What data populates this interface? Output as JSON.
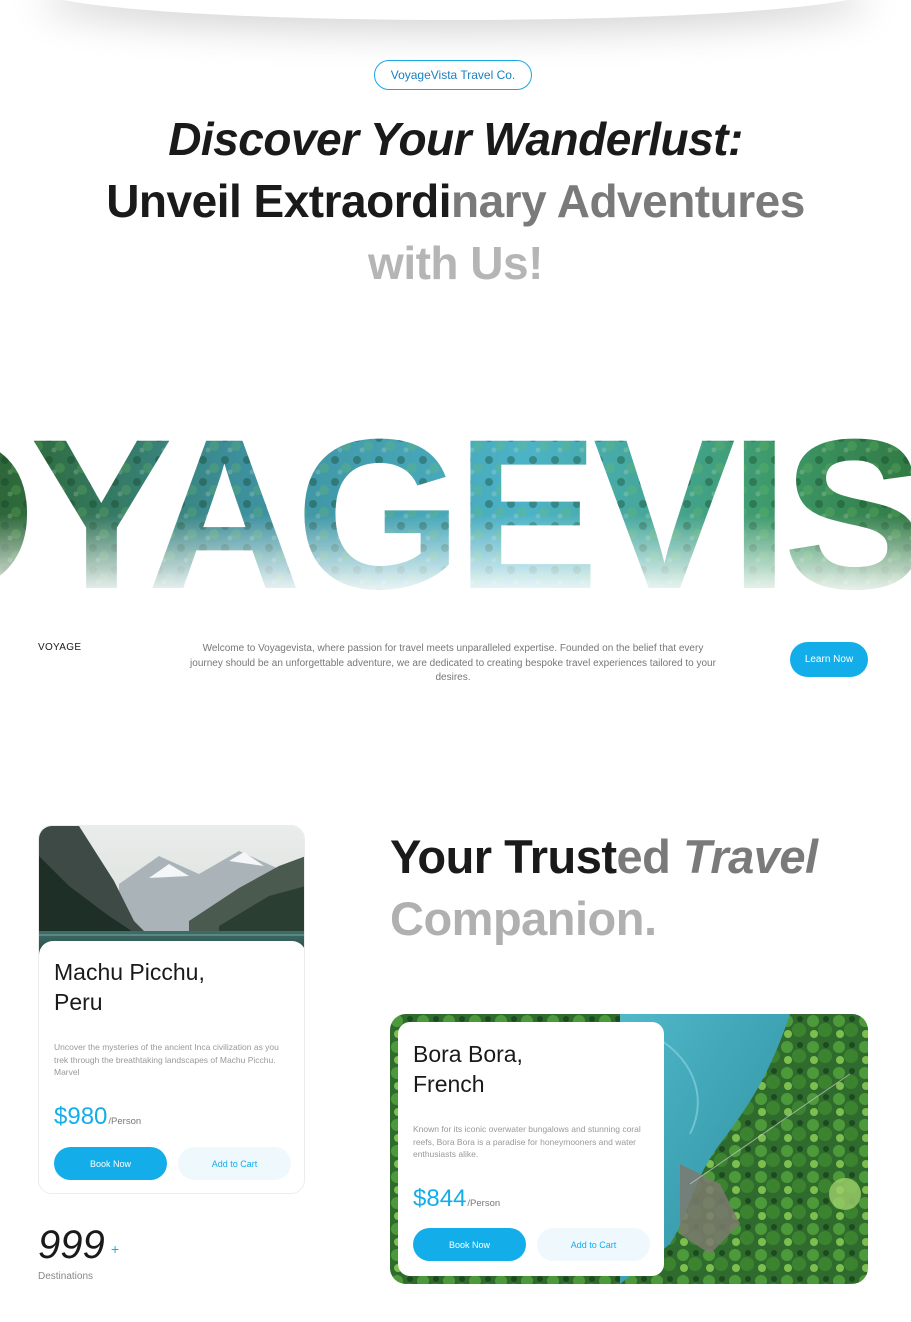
{
  "brand": {
    "pill_label": "VoyageVista Travel Co."
  },
  "hero": {
    "line1": "Discover Your Wanderlust:",
    "line2_dark": "Unveil Extraordi",
    "line2_mid": "nary Adventures",
    "line3": "with Us!"
  },
  "big_word": "VOYAGEVISTA",
  "intro": {
    "label": "VOYAGE",
    "text": "Welcome to Voyagevista, where passion for travel meets unparalleled expertise. Founded on the belief that every journey should be an unforgettable adventure, we are dedicated to creating bespoke travel experiences tailored to your desires.",
    "button_label": "Learn Now"
  },
  "section_title": {
    "part_dark": "Your Trust",
    "part_mid": "ed ",
    "part_italic": "Travel",
    "line2": "Companion."
  },
  "destinations": [
    {
      "title_line1": "Machu Picchu,",
      "title_line2": "Peru",
      "description": "Uncover the mysteries of the ancient Inca civilization as you trek through the breathtaking landscapes of Machu Picchu. Marvel",
      "price": "$980",
      "per": "/Person",
      "book_label": "Book Now",
      "cart_label": "Add to Cart"
    },
    {
      "title_line1": "Bora Bora,",
      "title_line2": "French",
      "description": "Known for its iconic overwater bungalows and stunning coral reefs, Bora Bora is a paradise for honeymooners and water enthusiasts alike.",
      "price": "$844",
      "per": "/Person",
      "book_label": "Book Now",
      "cart_label": "Add to Cart"
    }
  ],
  "stats": {
    "number": "999",
    "plus": "+",
    "label": "Destinations"
  },
  "colors": {
    "accent": "#13aeea",
    "text_dark": "#1a1a1a",
    "text_mid": "#7a7a7a",
    "text_light": "#b0b0b0"
  }
}
